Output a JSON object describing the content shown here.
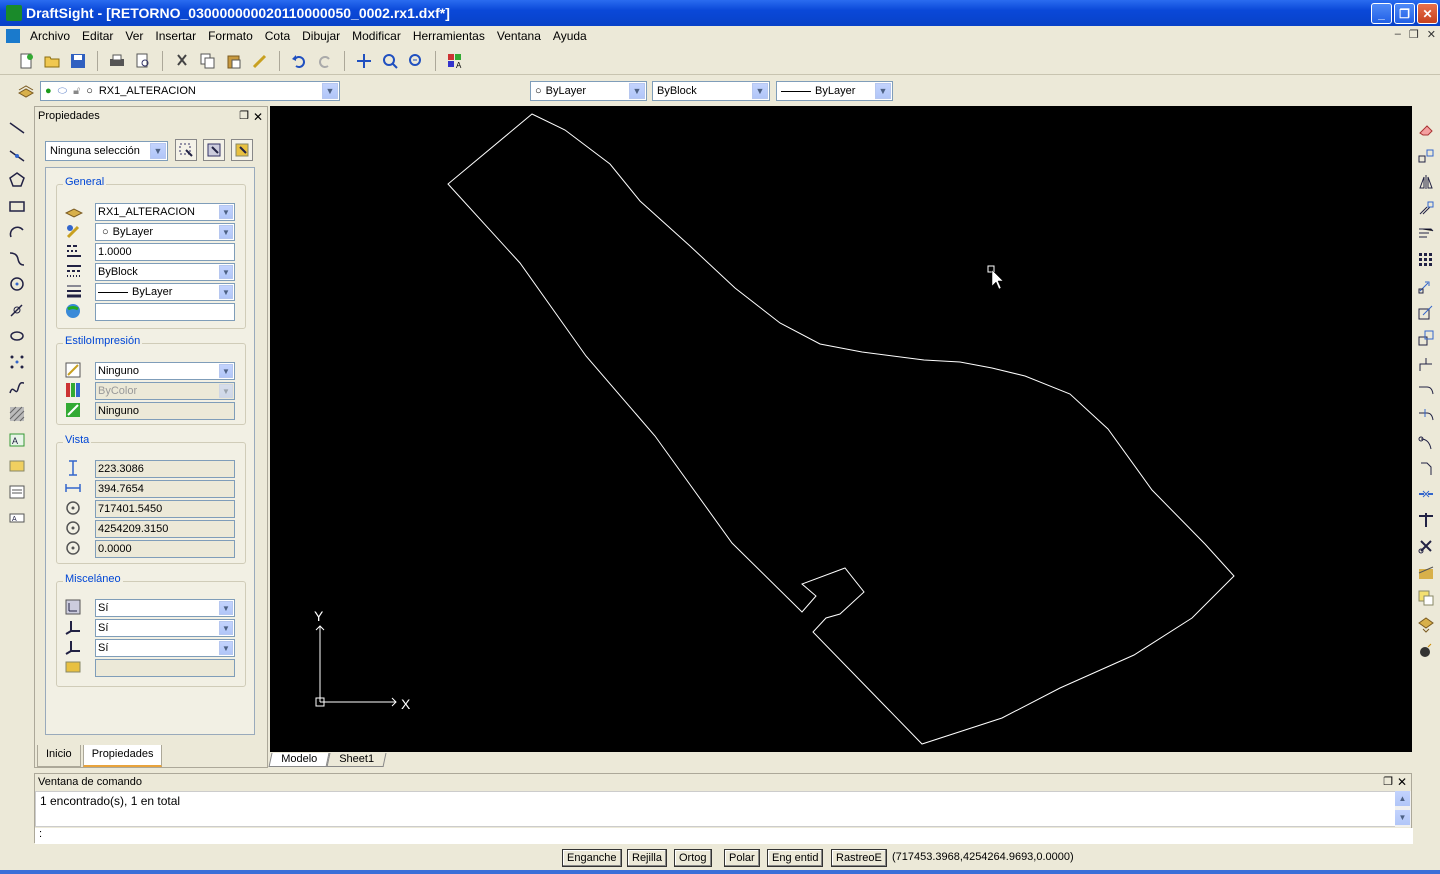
{
  "window": {
    "title": "DraftSight - [RETORNO_030000000020110000050_0002.rx1.dxf*]"
  },
  "menu": [
    "Archivo",
    "Editar",
    "Ver",
    "Insertar",
    "Formato",
    "Cota",
    "Dibujar",
    "Modificar",
    "Herramientas",
    "Ventana",
    "Ayuda"
  ],
  "layerbar": {
    "layer": "RX1_ALTERACION",
    "color": "ByLayer",
    "linestyle": "ByBlock",
    "lineweight": "ByLayer"
  },
  "props": {
    "title": "Propiedades",
    "selection": "Ninguna selección",
    "general": {
      "title": "General",
      "layer": "RX1_ALTERACION",
      "color": "ByLayer",
      "scale": "1.0000",
      "linestyle": "ByBlock",
      "lineweight": "ByLayer",
      "hyperlink": ""
    },
    "print": {
      "title": "EstiloImpresión",
      "style": "Ninguno",
      "table": "ByColor",
      "attached": "Ninguno"
    },
    "view": {
      "title": "Vista",
      "height": "223.3086",
      "width": "394.7654",
      "cx": "717401.5450",
      "cy": "4254209.3150",
      "cz": "0.0000"
    },
    "misc": {
      "title": "Misceláneo",
      "ucs_icon": "Sí",
      "ucs_origin": "Sí",
      "ucs_per_viewport": "Sí",
      "ucs_name": ""
    },
    "tabs": [
      "Inicio",
      "Propiedades"
    ]
  },
  "canvas": {
    "axis_y": "Y",
    "axis_x": "X"
  },
  "layout_tabs": [
    "Modelo",
    "Sheet1"
  ],
  "command": {
    "title": "Ventana de comando",
    "output": "1 encontrado(s), 1 en total",
    "prompt": ":"
  },
  "status": {
    "snap": "Enganche",
    "grid": "Rejilla",
    "ortho": "Ortog",
    "polar": "Polar",
    "esnap": "Eng entid",
    "etrack": "RastreoE",
    "coords": "(717453.3968,4254264.9693,0.0000)"
  },
  "colors": {
    "title_bar": "#0a48d8",
    "canvas": "#000000",
    "accent": "#0046d5"
  }
}
